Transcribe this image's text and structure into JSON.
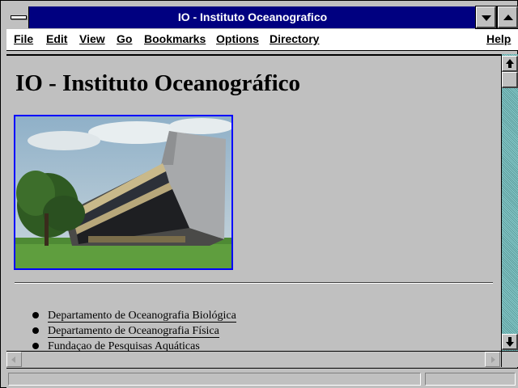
{
  "window": {
    "title": "IO - Instituto Oceanografico",
    "controls": {
      "system_menu_icon": "system-menu-bar-icon",
      "minimize_icon": "triangle-down-icon",
      "maximize_icon": "triangle-up-icon"
    }
  },
  "menubar": {
    "items": [
      {
        "label": "File"
      },
      {
        "label": "Edit"
      },
      {
        "label": "View"
      },
      {
        "label": "Go"
      },
      {
        "label": "Bookmarks"
      },
      {
        "label": "Options"
      },
      {
        "label": "Directory"
      },
      {
        "label": "Help"
      }
    ]
  },
  "page": {
    "heading": "IO - Instituto Oceanográfico",
    "image": {
      "subject": "building-photo",
      "border_color": "#0000ff"
    },
    "links": [
      {
        "text": "Departamento de Oceanografia Biológica"
      },
      {
        "text": "Departamento de Oceanografia Física"
      },
      {
        "text": "Fundaçao de Pesquisas Aquáticas"
      }
    ]
  },
  "scrollbars": {
    "vertical": {
      "up_icon": "arrow-up-icon",
      "down_icon": "arrow-down-icon"
    },
    "horizontal": {
      "left_icon": "arrow-left-icon",
      "right_icon": "arrow-right-icon"
    }
  },
  "colors": {
    "titlebar": "#000080",
    "window_bg": "#c0c0c0",
    "scroll_track": "#66aaaa",
    "link_border": "#0000ff"
  }
}
